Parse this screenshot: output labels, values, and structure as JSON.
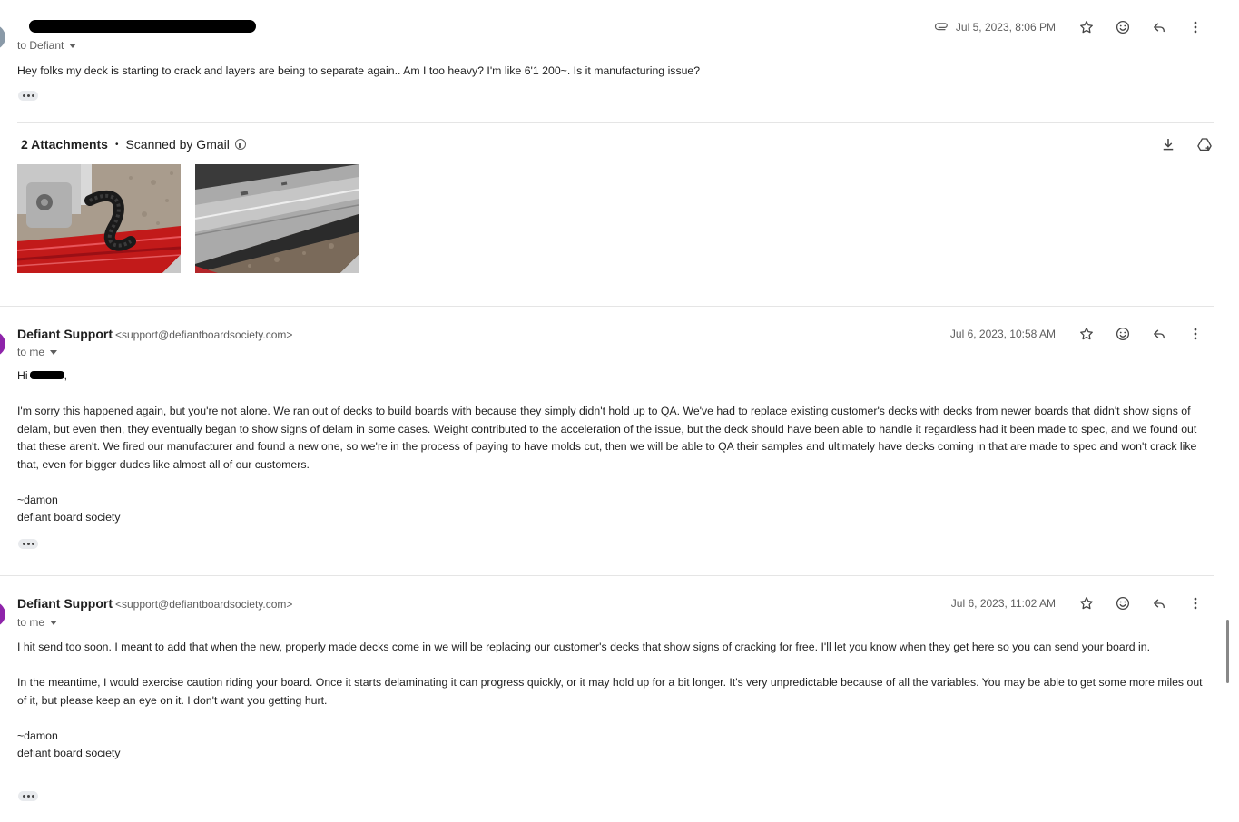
{
  "messages": [
    {
      "sender_name": "",
      "sender_email": "",
      "to_line": "to Defiant",
      "date": "Jul 5, 2023, 8:06 PM",
      "has_attachment_icon": true,
      "body": [
        "Hey folks my deck is starting to crack and layers are being to separate again..  Am I too heavy? I'm like 6'1 200~. Is it manufacturing issue?"
      ]
    },
    {
      "sender_name": "Defiant Support",
      "sender_email": "<support@defiantboardsociety.com>",
      "to_line": "to me",
      "date": "Jul 6, 2023, 10:58 AM",
      "greeting": "Hi",
      "greeting_suffix": ",",
      "body": [
        "I'm sorry this happened again, but you're not alone. We ran out of decks to build boards with because they simply didn't hold up to QA. We've had to replace existing customer's decks with decks from newer boards that didn't show signs of delam, but even then, they eventually began to show signs of delam in some cases. Weight contributed to the acceleration of the issue, but the deck should have been able to handle it regardless had it been made to spec, and we found out that these aren't. We fired our manufacturer and found a new one, so we're in the process of paying to have molds cut, then we will be able to QA their samples and ultimately have decks coming in that are made to spec and won't crack like that, even for bigger dudes like almost all of our customers."
      ],
      "signature": [
        "~damon",
        "defiant board society"
      ]
    },
    {
      "sender_name": "Defiant Support",
      "sender_email": "<support@defiantboardsociety.com>",
      "to_line": "to me",
      "date": "Jul 6, 2023, 11:02 AM",
      "body": [
        "I hit send too soon. I meant to add that when the new, properly made decks come in we will be replacing our customer's decks that show signs of cracking for free. I'll let you know when they get here so you can send your board in.",
        "In the meantime, I would exercise caution riding your board. Once it starts delaminating it can progress quickly, or it may hold up for a bit longer. It's very unpredictable because of all the variables. You may be able to get some more miles out of it, but please keep an eye on it. I don't want you getting hurt."
      ],
      "signature": [
        "~damon",
        "defiant board society"
      ]
    }
  ],
  "attachments": {
    "count_label": "2 Attachments",
    "separator": "•",
    "scanned_label": "Scanned by Gmail",
    "items": [
      {
        "name": "photo-1",
        "description_icon": "image-thumbnail"
      },
      {
        "name": "photo-2",
        "description_icon": "image-thumbnail"
      }
    ]
  },
  "colors": {
    "avatar_1": "#8a9aa8",
    "avatar_2": "#8e24aa",
    "avatar_3": "#8e24aa",
    "text": "#222222",
    "meta": "#5e5e5e"
  },
  "icons": {
    "attachment": "paperclip-icon",
    "star": "star-icon",
    "emoji": "emoji-icon",
    "reply": "reply-icon",
    "more": "more-vert-icon",
    "download": "download-icon",
    "drive": "add-to-drive-icon"
  }
}
